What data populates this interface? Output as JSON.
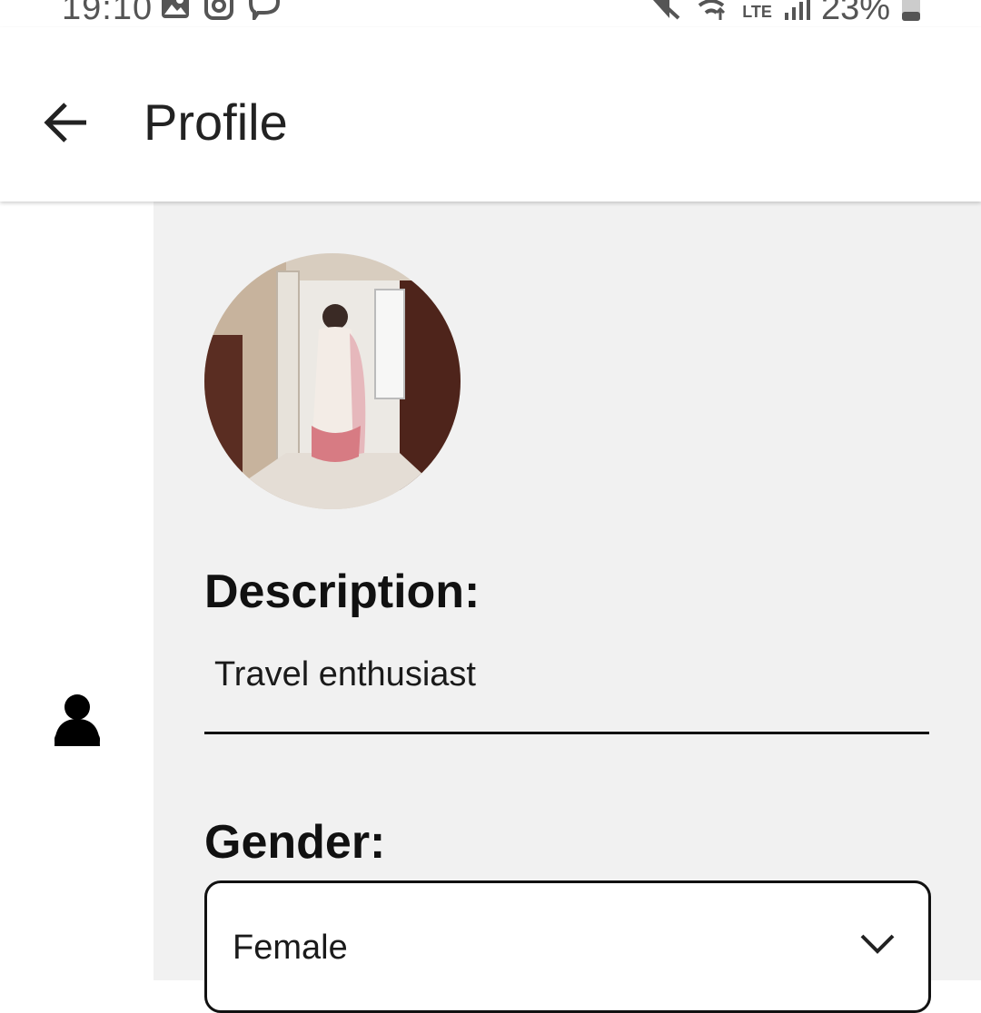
{
  "status_bar": {
    "time": "19:10",
    "battery": "23%",
    "network": "LTE",
    "icons_left": [
      "gallery-icon",
      "instagram-icon",
      "viber-icon"
    ],
    "icons_right": [
      "mute-icon",
      "wifi-icon",
      "volte-lte-icon",
      "signal-icon",
      "battery-icon"
    ]
  },
  "app_bar": {
    "title": "Profile",
    "back_icon": "arrow-back-icon"
  },
  "side_rail": {
    "items": [
      {
        "icon": "person-icon"
      }
    ]
  },
  "profile": {
    "avatar": "profile-photo",
    "description_label": "Description:",
    "description_value": "Travel enthusiast",
    "gender_label": "Gender:",
    "gender_value": "Female"
  },
  "colors": {
    "content_bg": "#f1f1f1",
    "text": "#111111",
    "app_bar_bg": "#ffffff"
  }
}
